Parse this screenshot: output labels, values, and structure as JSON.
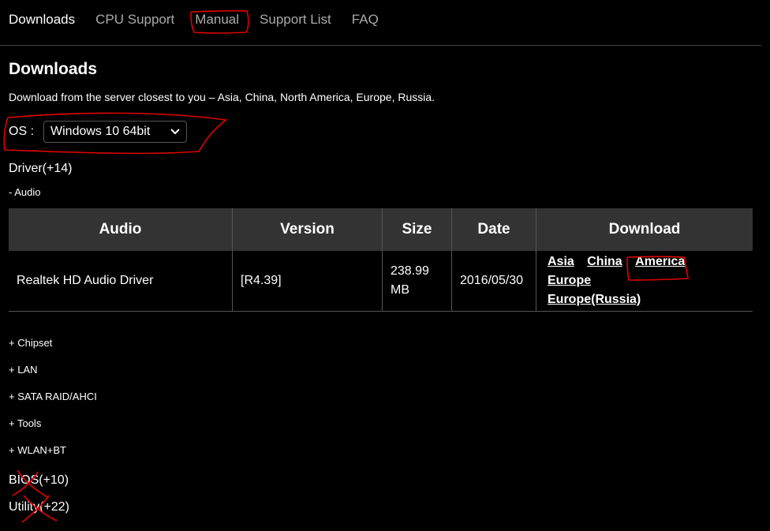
{
  "nav": [
    {
      "label": "Downloads",
      "active": true
    },
    {
      "label": "CPU Support"
    },
    {
      "label": "Manual"
    },
    {
      "label": "Support List"
    },
    {
      "label": "FAQ"
    }
  ],
  "heading": "Downloads",
  "subtitle": "Download from the server closest to you – Asia, China, North America, Europe, Russia.",
  "os": {
    "label": "OS :",
    "selected": "Windows 10 64bit"
  },
  "driver_label": "Driver(+14)",
  "audio_label": "- Audio",
  "table": {
    "headers": [
      "Audio",
      "Version",
      "Size",
      "Date",
      "Download"
    ],
    "rows": [
      {
        "name": "Realtek HD Audio Driver",
        "version": "[R4.39]",
        "size": "238.99 MB",
        "date": "2016/05/30",
        "links": [
          "Asia",
          "China",
          "America",
          "Europe",
          "Europe(Russia)"
        ]
      }
    ]
  },
  "categories": [
    "+ Chipset",
    "+ LAN",
    "+ SATA RAID/AHCI",
    "+ Tools",
    "+ WLAN+BT"
  ],
  "bios_label": "BIOS(+10)",
  "utility_label": "Utility(+22)",
  "annotation_color": "#e00000"
}
